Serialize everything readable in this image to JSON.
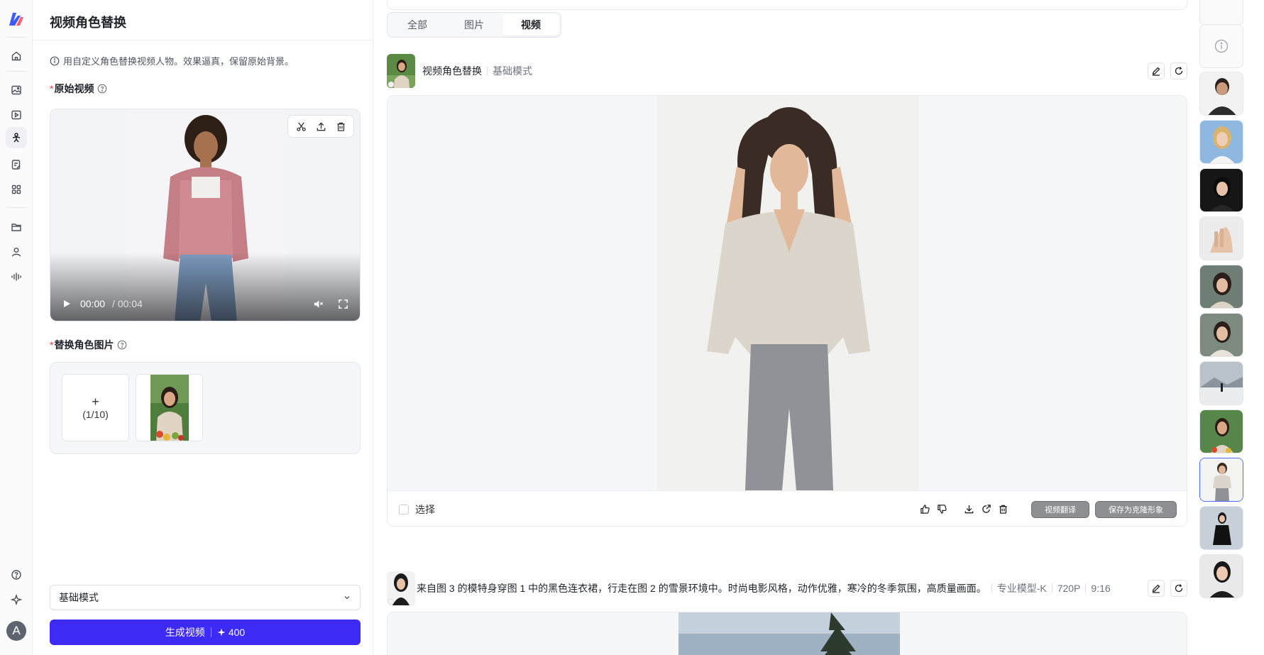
{
  "panel": {
    "title": "视频角色替换",
    "hint": "用自定义角色替换视频人物。效果逼真，保留原始背景。",
    "source_video_label": "原始视频",
    "required_mark": "*",
    "replace_image_label": "替换角色图片",
    "upload_count": "(1/10)",
    "add_symbol": "+",
    "video_current_time": "00:00",
    "video_duration": "/ 00:04",
    "mode_select_value": "基础模式",
    "generate_label": "生成视频",
    "generate_cost": "400"
  },
  "tabs": [
    {
      "label": "全部",
      "active": false
    },
    {
      "label": "图片",
      "active": false
    },
    {
      "label": "视频",
      "active": true
    }
  ],
  "task1": {
    "title": "视频角色替换",
    "mode": "基础模式",
    "select_label": "选择",
    "translate_button": "视频翻译",
    "save_clone_button": "保存为克隆形象"
  },
  "task2": {
    "prompt": "来自图 3 的模特身穿图 1 中的黑色连衣裙，行走在图 2 的雪景环境中。时尚电影风格，动作优雅，寒冷的冬季氛围，高质量画面。",
    "model": "专业模型-K",
    "resolution": "720P",
    "ratio": "9:16"
  },
  "user": {
    "avatar_letter": "A"
  },
  "colors": {
    "accent": "#3d2bf5",
    "selected_border": "#4b6bff",
    "required": "#f23c3c"
  },
  "rail_icons": [
    "home-icon",
    "image-edit-icon",
    "video-edit-icon",
    "character-icon",
    "document-edit-icon",
    "apps-icon",
    "folder-icon",
    "user-icon",
    "audio-wave-icon",
    "help-icon",
    "sparkle-icon"
  ]
}
